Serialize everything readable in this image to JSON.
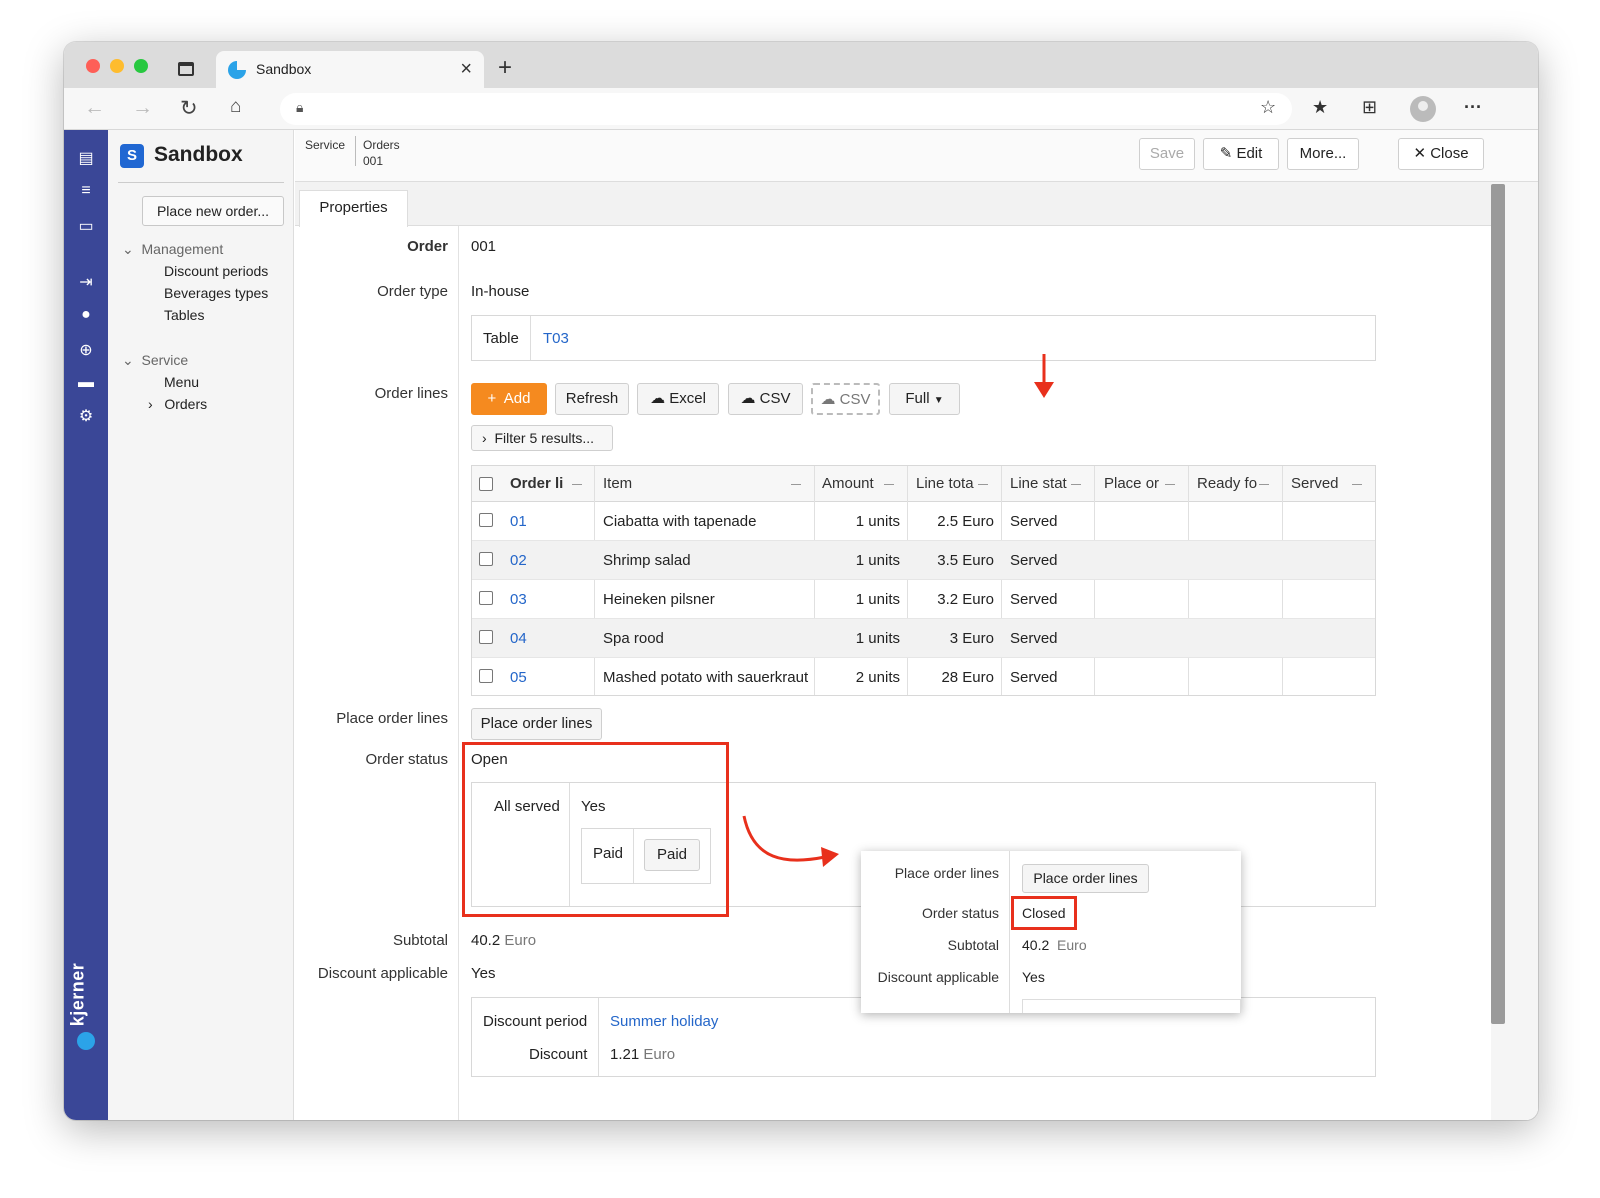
{
  "browser": {
    "tab_title": "Sandbox"
  },
  "app": {
    "name": "Sandbox",
    "logo_letter": "S",
    "brand": "kjerner"
  },
  "sidebar": {
    "place_new_order": "Place new order...",
    "groups": [
      {
        "label": "Management",
        "items": [
          "Discount periods",
          "Beverages types",
          "Tables"
        ]
      },
      {
        "label": "Service",
        "items": [
          "Menu",
          "Orders"
        ]
      }
    ]
  },
  "breadcrumb": {
    "section": "Service",
    "page": "Orders",
    "record": "001"
  },
  "toolbar": {
    "save": "Save",
    "edit": "Edit",
    "more": "More...",
    "close": "Close"
  },
  "tabs": {
    "properties": "Properties"
  },
  "form": {
    "order_label": "Order",
    "order_value": "001",
    "order_type_label": "Order type",
    "order_type_value": "In-house",
    "table_label": "Table",
    "table_value": "T03",
    "order_lines_label": "Order lines",
    "place_order_lines_label": "Place order lines",
    "place_order_lines_button": "Place order lines",
    "order_status_label": "Order status",
    "order_status_value": "Open",
    "all_served_label": "All served",
    "all_served_value": "Yes",
    "paid_label": "Paid",
    "paid_button": "Paid",
    "subtotal_label": "Subtotal",
    "subtotal_value": "40.2",
    "subtotal_unit": "Euro",
    "discount_applicable_label": "Discount applicable",
    "discount_applicable_value": "Yes",
    "discount_period_label": "Discount period",
    "discount_period_value": "Summer holiday",
    "discount_label": "Discount",
    "discount_value": "1.21",
    "discount_unit": "Euro"
  },
  "grid_toolbar": {
    "add": "Add",
    "refresh": "Refresh",
    "excel": "Excel",
    "csv": "CSV",
    "csv_dashed": "CSV",
    "full": "Full",
    "filter": "Filter 5 results..."
  },
  "grid": {
    "columns": [
      "Order li",
      "Item",
      "Amount",
      "Line tota",
      "Line stat",
      "Place or",
      "Ready fo",
      "Served"
    ],
    "rows": [
      {
        "id": "01",
        "item": "Ciabatta with tapenade",
        "amount": "1 units",
        "total": "2.5 Euro",
        "status": "Served"
      },
      {
        "id": "02",
        "item": "Shrimp salad",
        "amount": "1 units",
        "total": "3.5 Euro",
        "status": "Served"
      },
      {
        "id": "03",
        "item": "Heineken pilsner",
        "amount": "1 units",
        "total": "3.2 Euro",
        "status": "Served"
      },
      {
        "id": "04",
        "item": "Spa rood",
        "amount": "1 units",
        "total": "3 Euro",
        "status": "Served"
      },
      {
        "id": "05",
        "item": "Mashed potato with sauerkraut",
        "amount": "2 units",
        "total": "28 Euro",
        "status": "Served"
      }
    ]
  },
  "popup": {
    "place_order_lines_label": "Place order lines",
    "place_order_lines_button": "Place order lines",
    "order_status_label": "Order status",
    "order_status_value": "Closed",
    "subtotal_label": "Subtotal",
    "subtotal_value": "40.2",
    "subtotal_unit": "Euro",
    "discount_applicable_label": "Discount applicable",
    "discount_applicable_value": "Yes"
  },
  "colors": {
    "accent": "#f58a1f",
    "rail": "#3a4797",
    "link": "#2466c9",
    "annotation": "#e8301c"
  }
}
